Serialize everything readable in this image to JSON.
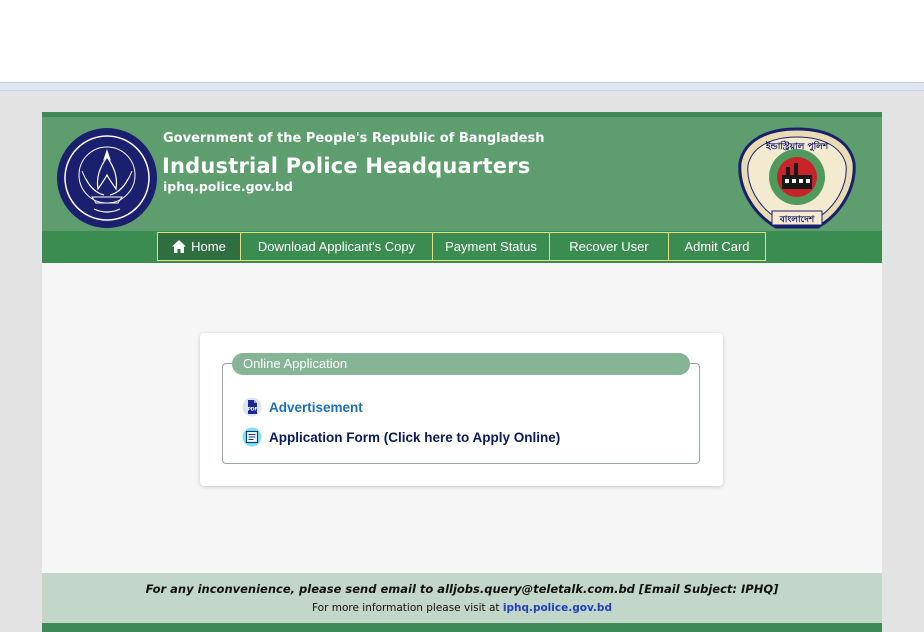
{
  "header": {
    "government": "Government of the People's Republic of Bangladesh",
    "title": "Industrial Police Headquarters",
    "site_url": "iphq.police.gov.bd",
    "left_logo": "bangladesh-police-emblem",
    "right_logo": "industrial-police-emblem",
    "right_logo_text_top": "ইন্ডাস্ট্রিয়াল পুলিশ",
    "right_logo_text_bottom": "বাংলাদেশ"
  },
  "nav": {
    "items": [
      {
        "label": "Home",
        "icon": "home-icon",
        "active": true
      },
      {
        "label": "Download Applicant's Copy"
      },
      {
        "label": "Payment Status"
      },
      {
        "label": "Recover User"
      },
      {
        "label": "Admit Card"
      }
    ]
  },
  "panel": {
    "legend": "Online Application",
    "links": [
      {
        "label": "Advertisement",
        "icon": "pdf-icon"
      },
      {
        "label": "Application Form (Click here to Apply Online)",
        "icon": "form-icon"
      }
    ]
  },
  "footer": {
    "line1": "For any inconvenience, please send email to alljobs.query@teletalk.com.bd [Email Subject: IPHQ]",
    "line2_prefix": "For more information please visit at",
    "line2_url": "iphq.police.gov.bd"
  },
  "colors": {
    "header_green": "#5e9e6e",
    "nav_green": "#3a8c50",
    "nav_border": "#e3e27a",
    "legend_green": "#86b596",
    "footer_green": "#c2d6c9",
    "link_blue": "#1e6fb3"
  }
}
